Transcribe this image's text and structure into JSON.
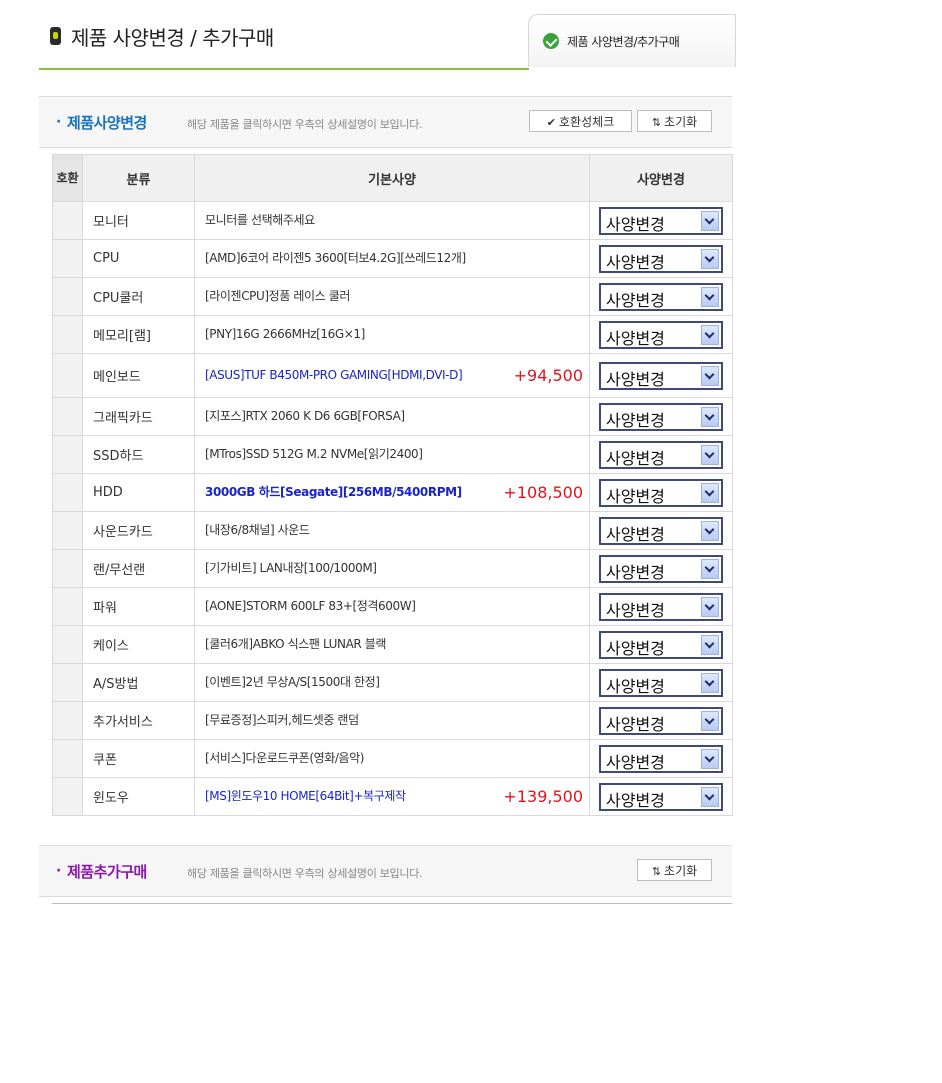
{
  "header": {
    "title": "제품 사양변경 / 추가구매",
    "tab_label": "제품 사양변경/추가구매"
  },
  "change_section": {
    "title": "제품사양변경",
    "description": "해당 제품을 클릭하시면 우측의 상세설명이 보입니다.",
    "compat_button": "호환성체크",
    "reset_button": "초기화"
  },
  "table": {
    "headers": {
      "compat": "호환",
      "category": "분류",
      "spec": "기본사양",
      "change": "사양변경"
    },
    "select_label": "사양변경",
    "rows": [
      {
        "category": "모니터",
        "spec": "모니터를 선택해주세요",
        "price": ""
      },
      {
        "category": "CPU",
        "spec": "[AMD]6코어 라이젠5 3600[터보4.2G][쓰레드12개]",
        "price": ""
      },
      {
        "category": "CPU쿨러",
        "spec": "[라이젠CPU]정품 레이스 쿨러",
        "price": ""
      },
      {
        "category": "메모리[램]",
        "spec": "[PNY]16G 2666MHz[16G×1]",
        "price": ""
      },
      {
        "category": "메인보드",
        "spec": "[ASUS]TUF B450M-PRO GAMING[HDMI,DVI-D]",
        "price": "+94,500"
      },
      {
        "category": "그래픽카드",
        "spec": "[지포스]RTX 2060 K D6 6GB[FORSA]",
        "price": ""
      },
      {
        "category": "SSD하드",
        "spec": "[MTros]SSD 512G M.2 NVMe[읽기2400]",
        "price": ""
      },
      {
        "category": "HDD",
        "spec": "3000GB 하드[Seagate][256MB/5400RPM]",
        "price": "+108,500"
      },
      {
        "category": "사운드카드",
        "spec": "[내장6/8채널] 사운드",
        "price": ""
      },
      {
        "category": "랜/무선랜",
        "spec": "[기가비트] LAN내장[100/1000M]",
        "price": ""
      },
      {
        "category": "파워",
        "spec": "[AONE]STORM 600LF 83+[정격600W]",
        "price": ""
      },
      {
        "category": "케이스",
        "spec": "[쿨러6개]ABKO 식스팬 LUNAR 블랙",
        "price": ""
      },
      {
        "category": "A/S방법",
        "spec": "[이벤트]2년 무상A/S[1500대 한정]",
        "price": ""
      },
      {
        "category": "추가서비스",
        "spec": "[무료증정]스피커,헤드셋중 랜덤",
        "price": ""
      },
      {
        "category": "쿠폰",
        "spec": "[서비스]다운로드쿠폰(영화/음악)",
        "price": ""
      },
      {
        "category": "윈도우",
        "spec": "[MS]윈도우10 HOME[64Bit]+복구제작",
        "price": "+139,500"
      }
    ]
  },
  "add_section": {
    "title": "제품추가구매",
    "description": "해당 제품을 클릭하시면 우측의 상세설명이 보입니다.",
    "reset_button": "초기화"
  },
  "colors": {
    "change_title": "#1a73b8",
    "add_title": "#8a1aa8",
    "price": "#e0141e",
    "changed_spec": "#1a24c9",
    "header_underline": "#8cbf3f"
  }
}
